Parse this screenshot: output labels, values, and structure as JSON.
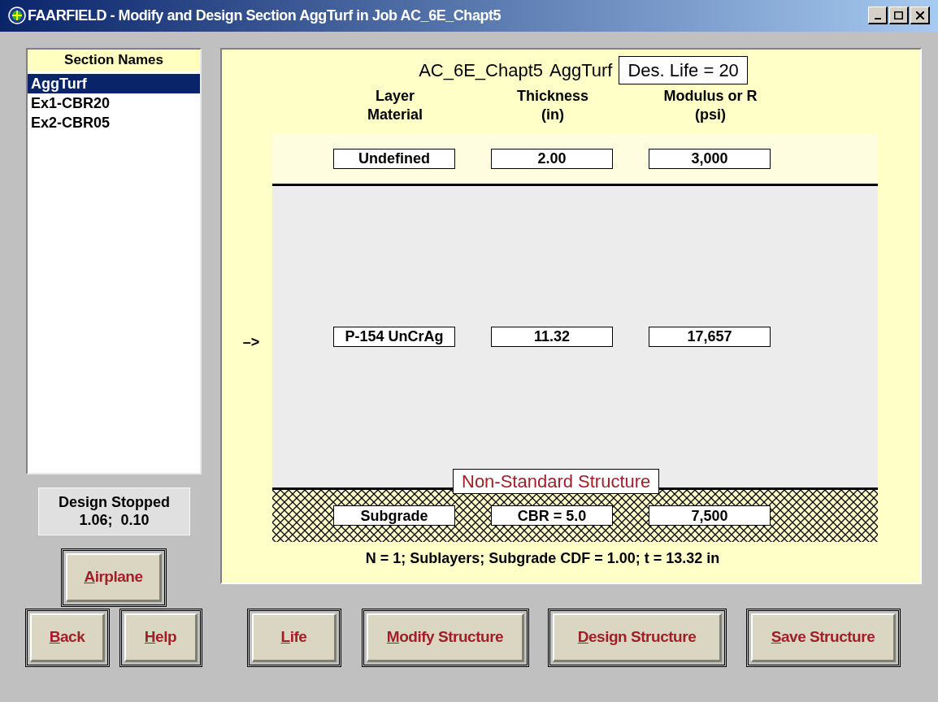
{
  "window": {
    "title": "FAARFIELD - Modify and Design Section AggTurf in Job AC_6E_Chapt5"
  },
  "sections": {
    "header": "Section Names",
    "items": [
      {
        "label": "AggTurf",
        "selected": true
      },
      {
        "label": "Ex1-CBR20",
        "selected": false
      },
      {
        "label": "Ex2-CBR05",
        "selected": false
      }
    ]
  },
  "status": {
    "line1": "Design Stopped",
    "line2": "1.06;  0.10"
  },
  "airplane_button": {
    "access_key": "A",
    "rest": "irplane"
  },
  "structure": {
    "job": "AC_6E_Chapt5",
    "section": "AggTurf",
    "design_life": "Des. Life = 20",
    "columns": [
      {
        "line1": "Layer",
        "line2": "Material"
      },
      {
        "line1": "Thickness",
        "line2": "(in)"
      },
      {
        "line1": "Modulus or R",
        "line2": "(psi)"
      }
    ],
    "layers": [
      {
        "kind": "surface",
        "material": "Undefined",
        "thickness": "2.00",
        "modulus": "3,000"
      },
      {
        "kind": "base",
        "material": "P-154 UnCrAg",
        "thickness": "11.32",
        "modulus": "17,657",
        "marker": "–>"
      },
      {
        "kind": "subgrade",
        "material": "Subgrade",
        "thickness": "CBR = 5.0",
        "modulus": "7,500"
      }
    ],
    "warning": "Non-Standard Structure",
    "summary": "N = 1; Sublayers; Subgrade CDF = 1.00; t = 13.32 in"
  },
  "buttons": [
    {
      "access_key": "B",
      "rest": "ack"
    },
    {
      "access_key": "H",
      "rest": "elp"
    },
    {
      "access_key": "L",
      "rest": "ife"
    },
    {
      "access_key": "M",
      "rest": "odify Structure"
    },
    {
      "access_key": "D",
      "rest": "esign Structure"
    },
    {
      "access_key": "S",
      "rest": "ave Structure"
    }
  ]
}
